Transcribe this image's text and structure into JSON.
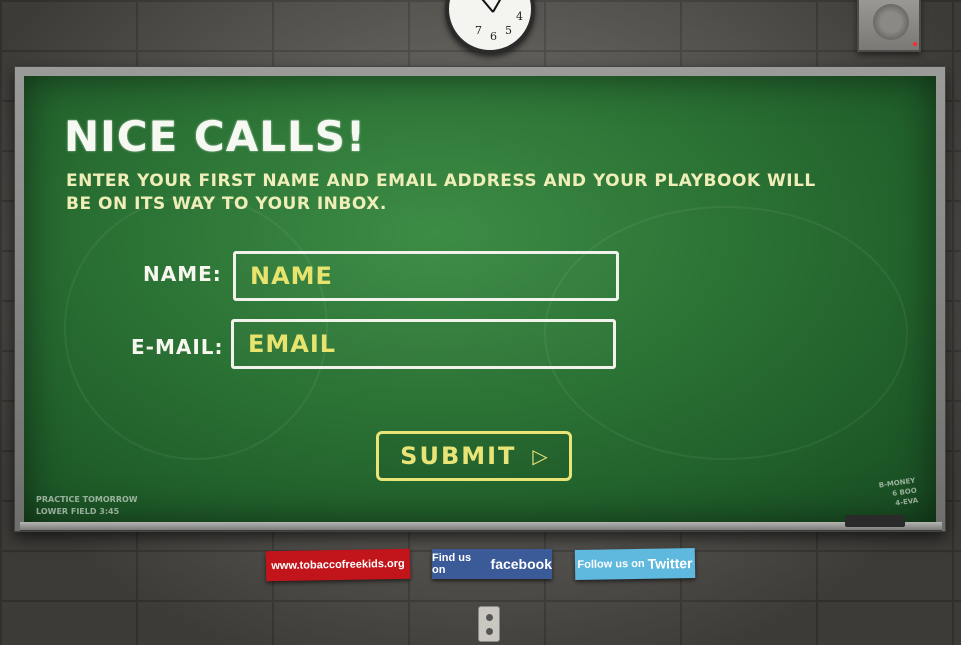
{
  "clock": {
    "numbers": [
      "7",
      "6",
      "5",
      "4"
    ]
  },
  "header": {
    "title": "Nice calls!",
    "subtitle": "Enter your first name and email address and your playbook will be on its way to your inbox."
  },
  "form": {
    "name_label": "Name:",
    "name_placeholder": "Name",
    "email_label": "E-mail:",
    "email_placeholder": "Email",
    "submit_label": "Submit"
  },
  "board_notes": {
    "left_line1": "Practice Tomorrow",
    "left_line2": "Lower Field 3:45",
    "right_line1": "B-Money",
    "right_line2": "6 Boo",
    "right_line3": "4-Eva"
  },
  "footer": {
    "tobacco_link": "www.tobaccofreekids.org",
    "facebook_prefix": "Find us on",
    "facebook_brand": "facebook",
    "twitter_prefix": "Follow us on",
    "twitter_brand": "Twitter"
  },
  "colors": {
    "board_green": "#2c7436",
    "chalk_yellow": "#e7e36d",
    "tobacco_red": "#c2151b",
    "facebook_blue": "#3b5a98",
    "twitter_blue": "#5fb8dd"
  },
  "icons": [
    "clock-icon",
    "speaker-icon",
    "play-arrow-icon",
    "outlet-icon"
  ]
}
